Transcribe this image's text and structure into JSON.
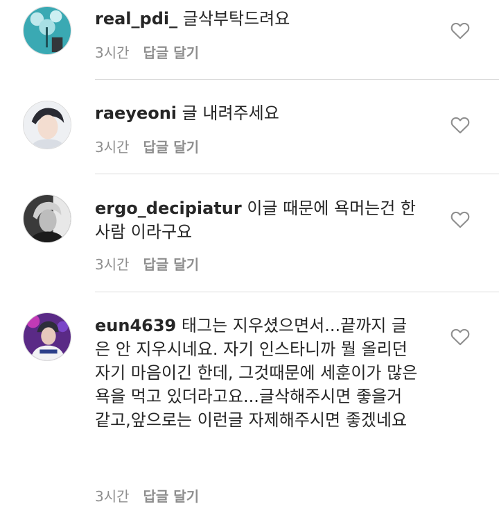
{
  "comments": [
    {
      "username": "real_pdi_",
      "text": "글삭부탁드려요",
      "time": "3시간",
      "reply": "답글 달기"
    },
    {
      "username": "raeyeoni",
      "text": "글 내려주세요",
      "time": "3시간",
      "reply": "답글 달기"
    },
    {
      "username": "ergo_decipiatur",
      "text": "이글 때문에 욕머는건 한사람 이라구요",
      "time": "3시간",
      "reply": "답글 달기"
    },
    {
      "username": "eun4639",
      "text": "태그는 지우셨으면서...끝까지 글은 안 지우시네요. 자기 인스타니까 뭘 올리던 자기 마음이긴 한데, 그것때문에 세훈이가 많은 욕을 먹고 있더라고요...글삭해주시면 좋을거 같고,앞으로는 이런글 자제해주시면 좋겠네요",
      "time": "3시간",
      "reply": "답글 달기"
    }
  ],
  "colors": {
    "meta": "#8e8e8e",
    "divider": "#dbdbdb",
    "heart": "#8e8e8e"
  },
  "icons": {
    "like": "heart-outline-icon"
  }
}
